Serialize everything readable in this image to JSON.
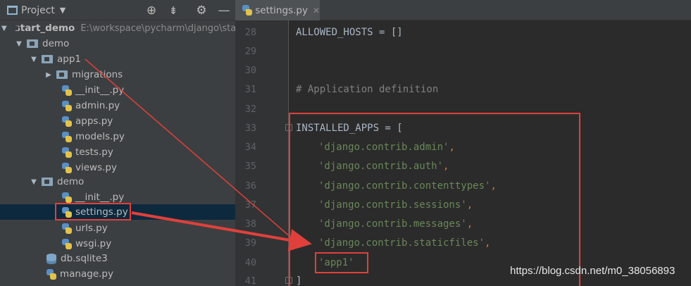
{
  "project_panel": {
    "title": "Project",
    "dropdown_glyph": "▼",
    "toolbar_icons": [
      "target-icon",
      "collapse-icon",
      "gear-icon",
      "minimize-icon"
    ],
    "tree": [
      {
        "label": "start_demo",
        "path": "E:\\workspace\\pycharm\\django\\sta",
        "arrow": "▼",
        "kind": "folder",
        "bold": true
      },
      {
        "label": "demo",
        "arrow": "▼",
        "kind": "folder"
      },
      {
        "label": "app1",
        "arrow": "▼",
        "kind": "folder"
      },
      {
        "label": "migrations",
        "arrow": "▶",
        "kind": "folder"
      },
      {
        "label": "__init__.py",
        "kind": "py"
      },
      {
        "label": "admin.py",
        "kind": "py"
      },
      {
        "label": "apps.py",
        "kind": "py"
      },
      {
        "label": "models.py",
        "kind": "py"
      },
      {
        "label": "tests.py",
        "kind": "py"
      },
      {
        "label": "views.py",
        "kind": "py"
      },
      {
        "label": "demo",
        "arrow": "▼",
        "kind": "folder"
      },
      {
        "label": "__init__.py",
        "kind": "py"
      },
      {
        "label": "settings.py",
        "kind": "py",
        "selected": true
      },
      {
        "label": "urls.py",
        "kind": "py"
      },
      {
        "label": "wsgi.py",
        "kind": "py"
      },
      {
        "label": "db.sqlite3",
        "kind": "db"
      },
      {
        "label": "manage.py",
        "kind": "py"
      }
    ]
  },
  "editor": {
    "tab_label": "settings.py",
    "tab_close": "✕",
    "lines": [
      {
        "num": "28",
        "text": "ALLOWED_HOSTS = []"
      },
      {
        "num": "29",
        "text": ""
      },
      {
        "num": "30",
        "text": ""
      },
      {
        "num": "31",
        "text": "# Application definition"
      },
      {
        "num": "32",
        "text": ""
      },
      {
        "num": "33",
        "text": "INSTALLED_APPS = ["
      },
      {
        "num": "34",
        "text": "'django.contrib.admin'"
      },
      {
        "num": "35",
        "text": "'django.contrib.auth'"
      },
      {
        "num": "36",
        "text": "'django.contrib.contenttypes'"
      },
      {
        "num": "37",
        "text": "'django.contrib.sessions'"
      },
      {
        "num": "38",
        "text": "'django.contrib.messages'"
      },
      {
        "num": "39",
        "text": "'django.contrib.staticfiles'"
      },
      {
        "num": "40",
        "text": "'app1'"
      },
      {
        "num": "41",
        "text": "]"
      }
    ],
    "comma": ","
  },
  "watermark": "https://blog.csdn.net/m0_38056893",
  "colors": {
    "panel_bg": "#3c3f41",
    "editor_bg": "#2b2b2b",
    "string": "#6a8759",
    "keyword_punct": "#cc7832",
    "comment": "#808080",
    "annotation": "#e0403b"
  }
}
